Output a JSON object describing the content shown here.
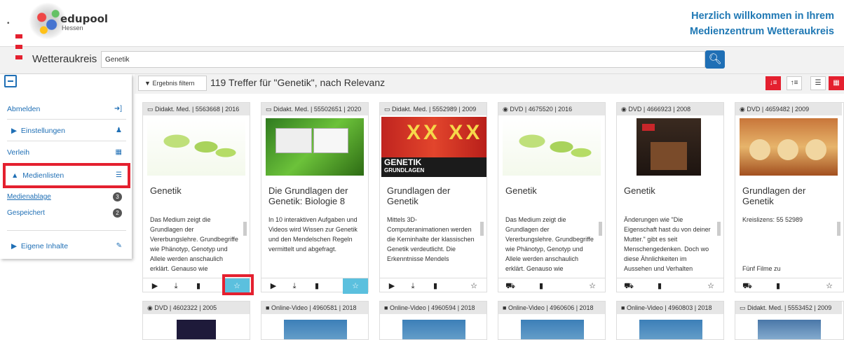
{
  "header": {
    "logo_brand": "edupool",
    "logo_sub": "Hessen",
    "welcome_line1": "Herzlich willkommen in Ihrem",
    "welcome_line2": "Medienzentrum Wetteraukreis"
  },
  "search": {
    "region": "Wetteraukreis",
    "value": "Genetik"
  },
  "sidebar": {
    "items": [
      {
        "label": "Abmelden"
      },
      {
        "label": "Einstellungen"
      },
      {
        "label": "Verleih"
      },
      {
        "label": "Medienlisten"
      },
      {
        "label": "Medienablage",
        "badge": "3"
      },
      {
        "label": "Gespeichert",
        "badge": "2"
      },
      {
        "label": "Eigene Inhalte"
      }
    ]
  },
  "toolbar": {
    "filter_label": "Ergebnis filtern",
    "hits_text": "119 Treffer für \"Genetik\", nach Relevanz"
  },
  "cards": [
    {
      "header": "Didakt. Med. | 5563668 | 2016",
      "title": "Genetik",
      "desc": "Das Medium zeigt die Grundlagen der Vererbungslehre. Grundbegriffe wie Phänotyp, Genotyp und Allele werden anschaulich erklärt. Genauso wie"
    },
    {
      "header": "Didakt. Med. | 55502651 | 2020",
      "title": "Die Grundlagen der Genetik: Biologie 8",
      "desc": "In 10 interaktiven Aufgaben und Videos wird Wissen zur Genetik und den Mendelschen Regeln vermittelt und abgefragt."
    },
    {
      "header": "Didakt. Med. | 5552989 | 2009",
      "title": "Grundlagen der Genetik",
      "desc": "Mittels 3D-Computeranimationen werden die Kerninhalte der klassischen Genetik verdeutlicht. Die Erkenntnisse Mendels",
      "img_text1": "GENETIK",
      "img_text2": "GRUNDLAGEN"
    },
    {
      "header": "DVD | 4675520 | 2016",
      "title": "Genetik",
      "desc": "Das Medium zeigt die Grundlagen der Vererbungslehre. Grundbegriffe wie Phänotyp, Genotyp und Allele werden anschaulich erklärt. Genauso wie"
    },
    {
      "header": "DVD | 4666923 | 2008",
      "title": "Genetik",
      "desc": "Änderungen wie \"Die Eigenschaft hast du von deiner Mutter.\" gibt es seit Menschengedenken. Doch wo diese Ähnlichkeiten im Aussehen und Verhalten herkommen, wird erst seit"
    },
    {
      "header": "DVD | 4659482 | 2009",
      "title": "Grundlagen der Genetik",
      "desc": "Kreislizens: 55 52989",
      "desc2": "Fünf Filme zu"
    }
  ],
  "cards_row2": [
    {
      "header": "DVD | 4602322 | 2005"
    },
    {
      "header": "Online-Video | 4960581 | 2018"
    },
    {
      "header": "Online-Video | 4960594 | 2018"
    },
    {
      "header": "Online-Video | 4960606 | 2018"
    },
    {
      "header": "Online-Video | 4960803 | 2018"
    },
    {
      "header": "Didakt. Med. | 5553452 | 2009"
    }
  ],
  "colors": {
    "accent": "#1f6fb5",
    "highlight": "#e4202f",
    "fav": "#5bc0de"
  }
}
